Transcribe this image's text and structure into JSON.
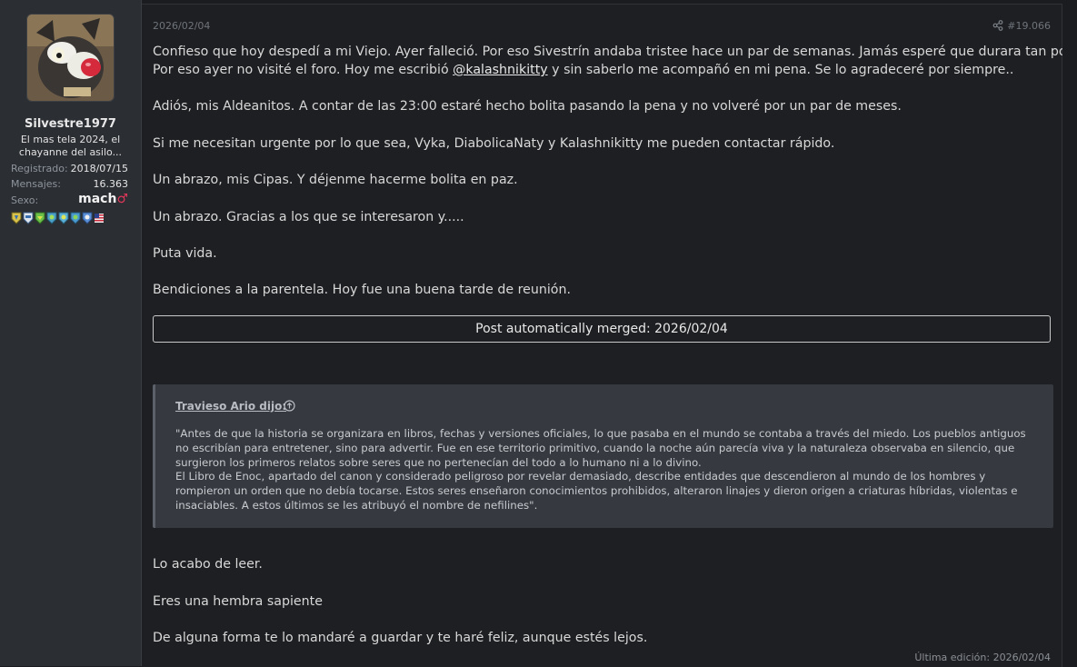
{
  "user": {
    "name": "Silvestre1977",
    "title_lines": [
      "El mas tela 2024, el",
      "chayanne del asilo..."
    ],
    "stats": [
      {
        "key": "Registrado:",
        "value": "2018/07/15"
      },
      {
        "key": "Mensajes:",
        "value": "16.363"
      },
      {
        "key": "Sexo:",
        "value": "mach",
        "symbol": "♂"
      }
    ],
    "badge_count": 8
  },
  "post": {
    "date": "2026/02/04",
    "number": "#19.066",
    "paragraphs": [
      "Confieso que hoy despedí a mi Viejo. Ayer falleció. Por eso Sivestrín andaba tristee hace un par de semanas. Jamás esperé que durara tan poco.",
      "Por eso ayer no visité el foro. Hoy me escribió ",
      "@kalashnikitty",
      " y sin saberlo me acompañó en mi pena. Se lo agradeceré por siempre..",
      "Adiós, mis Aldeanitos. A contar de las 23:00 estaré hecho bolita pasando la pena y no volveré por un par de meses.",
      "Si me necesitan urgente por lo que sea, Vyka, DiabolicaNaty y Kalashnikitty me pueden contactar rápido.",
      "Un abrazo, mis Cipas. Y déjenme hacerme bolita en paz.",
      "Un abrazo. Gracias a los que se interesaron y.....",
      "Puta vida.",
      "Bendiciones a la parentela. Hoy fue una buena tarde de reunión."
    ],
    "merged_label": "Post automatically merged: 2026/02/04",
    "quote": {
      "author": "Travieso Ario dijo:",
      "lines": [
        "\"Antes de que la historia se organizara en libros, fechas y versiones oficiales, lo que pasaba en el mundo se contaba a través del miedo. Los pueblos antiguos",
        "no escribían para entretener, sino para advertir. Fue en ese territorio primitivo, cuando la noche aún parecía viva y la naturaleza observaba en silencio, que",
        "surgieron los primeros relatos sobre seres que no pertenecían del todo a lo humano ni a lo divino.",
        "El Libro de Enoc, apartado del canon y considerado peligroso por revelar demasiado, describe entidades que descendieron al mundo de los hombres y",
        "rompieron un orden que no debía tocarse. Estos seres enseñaron conocimientos prohibidos, alteraron linajes y dieron origen a criaturas híbridas, violentas e",
        "insaciables. A estos últimos se les atribuyó el nombre de nefilines\"."
      ]
    },
    "after_paragraphs": [
      "Lo acabo de leer.",
      "Eres una hembra sapiente",
      "De alguna forma te lo mandaré a guardar y te haré feliz, aunque estés lejos."
    ],
    "edited": "Última edición: 2026/02/04"
  },
  "colors": {
    "background": "#1b1c1f",
    "sidebar": "#2b2e33",
    "quote_bg": "#36393f",
    "male_symbol": "#e0365a"
  },
  "icons": {
    "share": "share-icon",
    "quote_jump": "arrow-up-circle-icon"
  }
}
